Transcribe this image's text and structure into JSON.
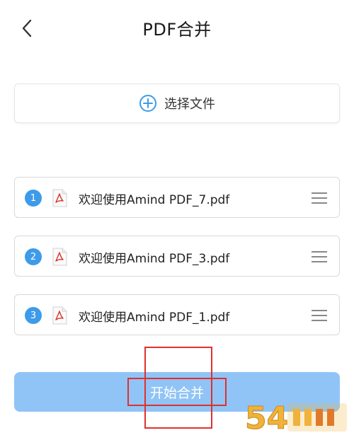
{
  "header": {
    "title": "PDF合并",
    "back_icon": "chevron-left-icon"
  },
  "select_file": {
    "label": "选择文件",
    "icon": "plus-circle-icon",
    "accent": "#3d9be9"
  },
  "files": [
    {
      "index": "1",
      "name": "欢迎使用Amind PDF_7.pdf"
    },
    {
      "index": "2",
      "name": "欢迎使用Amind PDF_3.pdf"
    },
    {
      "index": "3",
      "name": "欢迎使用Amind PDF_1.pdf"
    }
  ],
  "file_item_icons": {
    "file": "pdf-file-icon",
    "handle": "drag-handle-icon"
  },
  "start_button": {
    "label": "开始合并",
    "color": "#90c4f6"
  },
  "annotation_color": "#e0302c",
  "watermark": {
    "text": "54"
  }
}
